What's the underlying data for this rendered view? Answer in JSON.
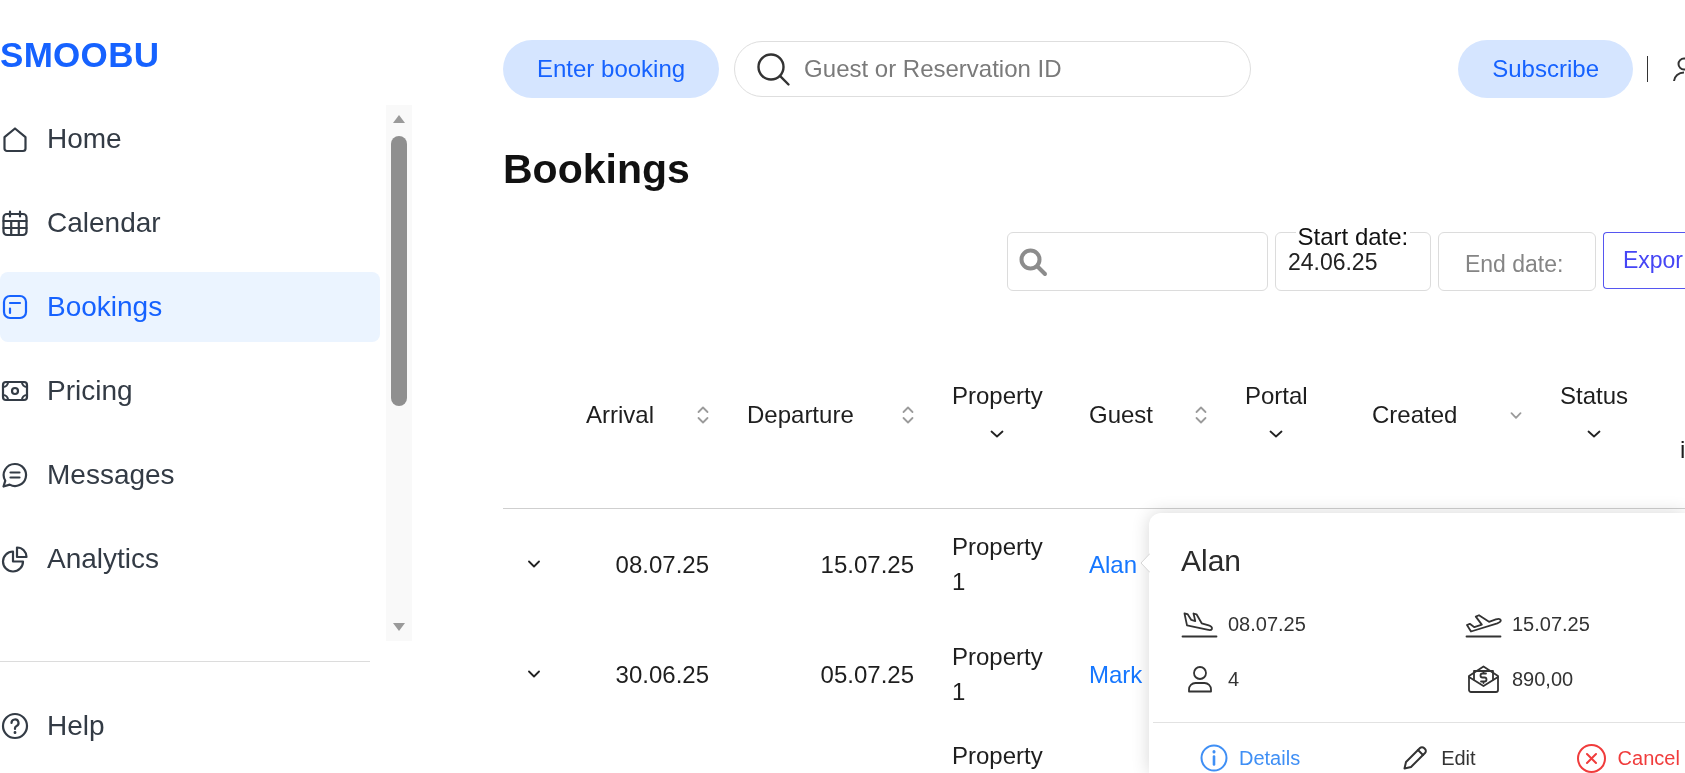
{
  "sidebar": {
    "logo": "SMOOBU",
    "items": [
      {
        "label": "Home",
        "selected": false
      },
      {
        "label": "Calendar",
        "selected": false
      },
      {
        "label": "Bookings",
        "selected": true
      },
      {
        "label": "Pricing",
        "selected": false
      },
      {
        "label": "Messages",
        "selected": false
      },
      {
        "label": "Analytics",
        "selected": false
      }
    ],
    "footer_items": [
      {
        "label": "Help"
      }
    ]
  },
  "top_bar": {
    "enter_booking_button": "Enter booking",
    "search": {
      "placeholder": "Guest or Reservation ID"
    },
    "subscribe_button": "Subscribe"
  },
  "page_title": "Bookings",
  "filters": {
    "start_date": {
      "label": "Start date:",
      "value": "24.06.25"
    },
    "end_date": {
      "placeholder": "End date:"
    },
    "export_button": "Expor"
  },
  "table": {
    "columns": [
      {
        "label": "Arrival",
        "kind": "sortable"
      },
      {
        "label": "Departure",
        "kind": "sortable"
      },
      {
        "label": "Property",
        "kind": "dropdown"
      },
      {
        "label": "Guest",
        "kind": "sortable"
      },
      {
        "label": "Portal",
        "kind": "dropdown"
      },
      {
        "label": "Created",
        "kind": "sorted"
      },
      {
        "label": "Status",
        "kind": "dropdown"
      },
      {
        "label": "i",
        "kind": "plain"
      }
    ],
    "rows": [
      {
        "arrival": "08.07.25",
        "departure": "15.07.25",
        "property": "Property 1",
        "guest": "Alan"
      },
      {
        "arrival": "30.06.25",
        "departure": "05.07.25",
        "property": "Property 1",
        "guest": "Mark"
      },
      {
        "property": "Property"
      }
    ]
  },
  "booking_popover": {
    "title": "Alan",
    "arrival": "08.07.25",
    "departure": "15.07.25",
    "guests": "4",
    "price": "890,00",
    "actions": [
      {
        "label": "Details",
        "kind": "details"
      },
      {
        "label": "Edit",
        "kind": "edit"
      },
      {
        "label": "Cancel",
        "kind": "cancel"
      }
    ]
  }
}
